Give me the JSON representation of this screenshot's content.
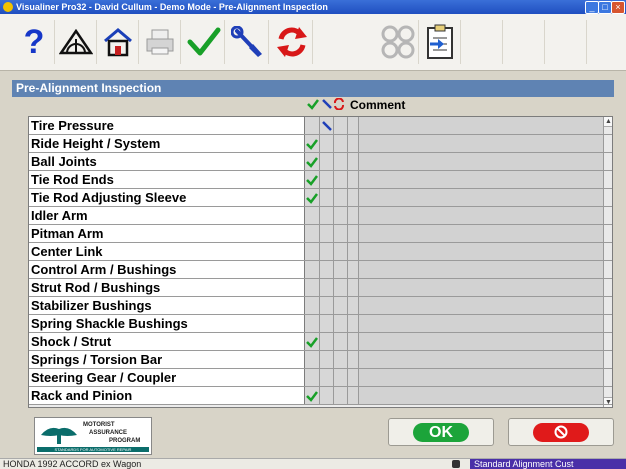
{
  "window": {
    "title": "Visualiner Pro32 - David Cullum - Demo Mode - Pre-Alignment Inspection"
  },
  "toolbar": {
    "items": [
      "help-icon",
      "alignment-icon",
      "home-icon",
      "print-icon",
      "check-icon",
      "wrench-icon",
      "replace-icon",
      "wheels-icon",
      "clipboard-icon"
    ]
  },
  "inspection": {
    "title": "Pre-Alignment Inspection",
    "comment_label": "Comment",
    "rows": [
      {
        "label": "Tire Pressure",
        "ok": false,
        "adjust": true,
        "replace": false
      },
      {
        "label": "Ride Height / System",
        "ok": true,
        "adjust": false,
        "replace": false
      },
      {
        "label": "Ball Joints",
        "ok": true,
        "adjust": false,
        "replace": false
      },
      {
        "label": "Tie Rod Ends",
        "ok": true,
        "adjust": false,
        "replace": false
      },
      {
        "label": "Tie Rod Adjusting Sleeve",
        "ok": true,
        "adjust": false,
        "replace": false
      },
      {
        "label": "Idler Arm",
        "ok": false,
        "adjust": false,
        "replace": false
      },
      {
        "label": "Pitman Arm",
        "ok": false,
        "adjust": false,
        "replace": false
      },
      {
        "label": "Center Link",
        "ok": false,
        "adjust": false,
        "replace": false
      },
      {
        "label": "Control Arm / Bushings",
        "ok": false,
        "adjust": false,
        "replace": false
      },
      {
        "label": "Strut Rod / Bushings",
        "ok": false,
        "adjust": false,
        "replace": false
      },
      {
        "label": "Stabilizer Bushings",
        "ok": false,
        "adjust": false,
        "replace": false
      },
      {
        "label": "Spring Shackle Bushings",
        "ok": false,
        "adjust": false,
        "replace": false
      },
      {
        "label": "Shock / Strut",
        "ok": true,
        "adjust": false,
        "replace": false
      },
      {
        "label": "Springs / Torsion Bar",
        "ok": false,
        "adjust": false,
        "replace": false
      },
      {
        "label": "Steering Gear / Coupler",
        "ok": false,
        "adjust": false,
        "replace": false
      },
      {
        "label": "Rack and Pinion",
        "ok": true,
        "adjust": false,
        "replace": false
      }
    ]
  },
  "logo": {
    "line1": "MOTORIST",
    "line2": "ASSURANCE",
    "line3": "PROGRAM",
    "tagline": "STANDARDS FOR AUTOMOTIVE REPAIR"
  },
  "buttons": {
    "ok_label": "OK"
  },
  "status": {
    "vehicle": "HONDA 1992 ACCORD ex Wagon",
    "mode": "Standard Alignment Cust"
  },
  "colors": {
    "check": "#18a028",
    "wrench": "#1f3fb8",
    "replace": "#d81818",
    "header": "#5f83b3"
  }
}
